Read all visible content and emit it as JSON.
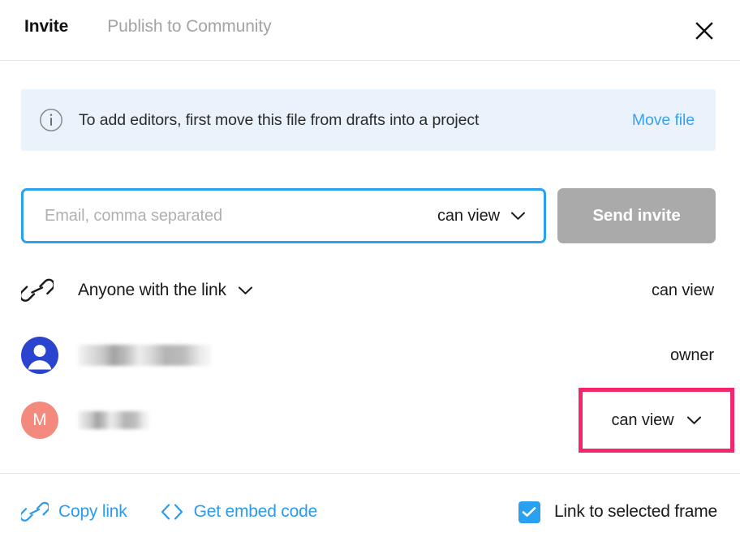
{
  "dialog": {
    "tabs": [
      {
        "label": "Invite",
        "active": true
      },
      {
        "label": "Publish to Community",
        "active": false
      }
    ],
    "close_icon": "close-icon"
  },
  "banner": {
    "icon": "info-circle-icon",
    "message": "To add editors, first move this file from drafts into a project",
    "action_label": "Move file",
    "background_color": "#eaf3fb",
    "action_color": "#3ba1f2"
  },
  "invite": {
    "email_placeholder": "Email, comma separated",
    "email_value": "",
    "permission_label": "can view",
    "permission_chevron": "chevron-down-icon",
    "send_label": "Send invite",
    "send_disabled": true,
    "focus_border_color": "#2aa0f0",
    "send_button_color": "#aaaaaa"
  },
  "share_rows": [
    {
      "type": "link",
      "icon": "link-chain-icon",
      "label": "Anyone with the link",
      "has_chevron": true,
      "permission": "can view"
    },
    {
      "type": "user",
      "avatar": "person-avatar-icon",
      "avatar_color": "#2b44d0",
      "avatar_initial": "",
      "name_redacted": true,
      "permission": "owner"
    },
    {
      "type": "user",
      "avatar": "letter-avatar",
      "avatar_color": "#f48a7d",
      "avatar_initial": "M",
      "name_redacted": true,
      "permission": "can view",
      "highlighted": true,
      "highlight_color": "#f5276c"
    }
  ],
  "footer": {
    "copy_link_label": "Copy link",
    "copy_link_icon": "link-chain-icon",
    "embed_label": "Get embed code",
    "embed_icon": "code-brackets-icon",
    "checkbox_label": "Link to selected frame",
    "checkbox_checked": true,
    "link_color": "#2b9bf0",
    "checkbox_color": "#2aa0f0"
  }
}
